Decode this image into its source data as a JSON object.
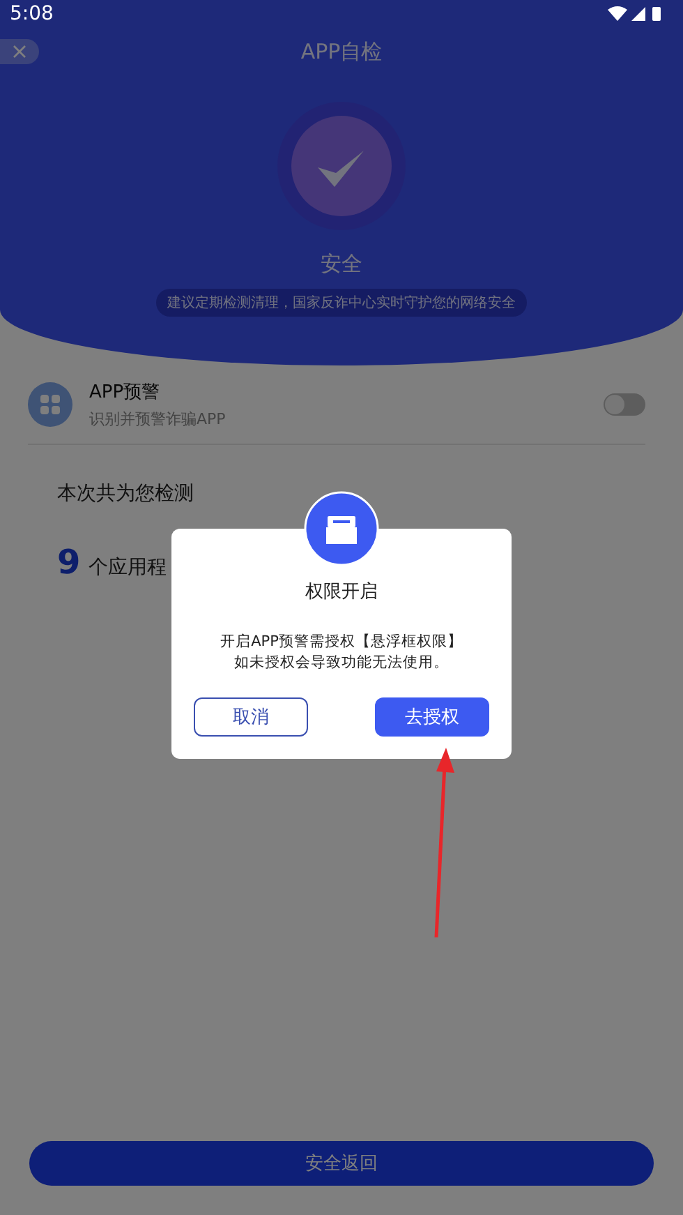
{
  "status_bar": {
    "time": "5:08"
  },
  "header": {
    "title": "APP自检",
    "status": "安全",
    "tip": "建议定期检测清理，国家反诈中心实时守护您的网络安全"
  },
  "feature": {
    "title": "APP预警",
    "subtitle": "识别并预警诈骗APP",
    "on": false
  },
  "summary": {
    "intro": "本次共为您检测",
    "count": "9",
    "count_label": "个应用程"
  },
  "footer_button": "安全返回",
  "dialog": {
    "title": "权限开启",
    "message_lines": [
      "开启APP预警需授权【悬浮框权限】",
      "如未授权会导致功能无法使用。"
    ],
    "buttons": [
      {
        "label": "取消",
        "kind": "outline"
      },
      {
        "label": "去授权",
        "kind": "primary"
      }
    ]
  }
}
